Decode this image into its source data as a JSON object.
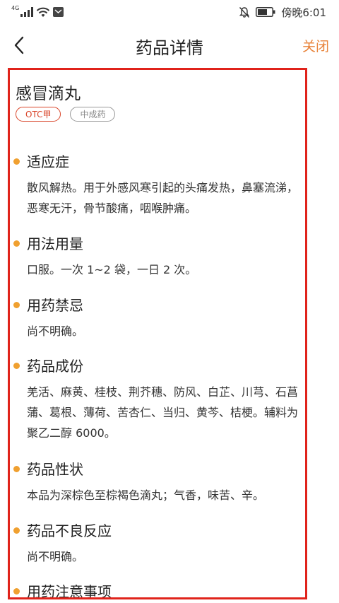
{
  "status_bar": {
    "network": "4G",
    "time": "傍晚6:01"
  },
  "nav": {
    "title": "药品详情",
    "close_label": "关闭"
  },
  "drug": {
    "name": "感冒滴丸",
    "tags": [
      "OTC甲",
      "中成药"
    ]
  },
  "sections": [
    {
      "title": "适应症",
      "body": "散风解热。用于外感风寒引起的头痛发热，鼻塞流涕，恶寒无汗，骨节酸痛，咽喉肿痛。"
    },
    {
      "title": "用法用量",
      "body": "口服。一次 1~2 袋，一日 2 次。"
    },
    {
      "title": "用药禁忌",
      "body": "尚不明确。"
    },
    {
      "title": "药品成份",
      "body": "羌活、麻黄、桂枝、荆芥穗、防风、白芷、川芎、石菖蒲、葛根、薄荷、苦杏仁、当归、黄芩、桔梗。辅料为聚乙二醇 6000。"
    },
    {
      "title": "药品性状",
      "body": "本品为深棕色至棕褐色滴丸；气香，味苦、辛。"
    },
    {
      "title": "药品不良反应",
      "body": "尚不明确。"
    },
    {
      "title": "用药注意事项",
      "body": ""
    }
  ],
  "colors": {
    "accent": "#e8833a",
    "bullet": "#f0a030",
    "frame": "#e0231b",
    "otc_tag": "#d9452a"
  }
}
